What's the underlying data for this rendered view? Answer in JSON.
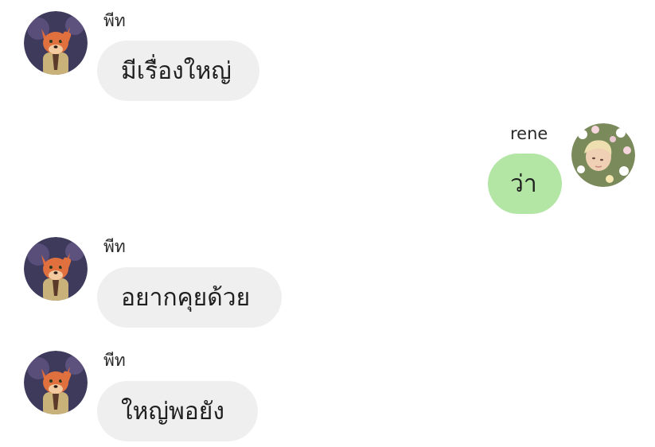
{
  "colors": {
    "incoming_bubble": "#efefef",
    "outgoing_bubble": "#b3e6a5"
  },
  "messages": [
    {
      "sender": "พีท",
      "text": "มีเรื่องใหญ่",
      "side": "incoming",
      "avatar_icon": "fox-avatar-icon"
    },
    {
      "sender": "rene",
      "text": "ว่า",
      "side": "outgoing",
      "avatar_icon": "person-in-flowers-avatar-icon"
    },
    {
      "sender": "พีท",
      "text": "อยากคุยด้วย",
      "side": "incoming",
      "avatar_icon": "fox-avatar-icon"
    },
    {
      "sender": "พีท",
      "text": "ใหญ่พอยัง",
      "side": "incoming",
      "avatar_icon": "fox-avatar-icon"
    }
  ]
}
